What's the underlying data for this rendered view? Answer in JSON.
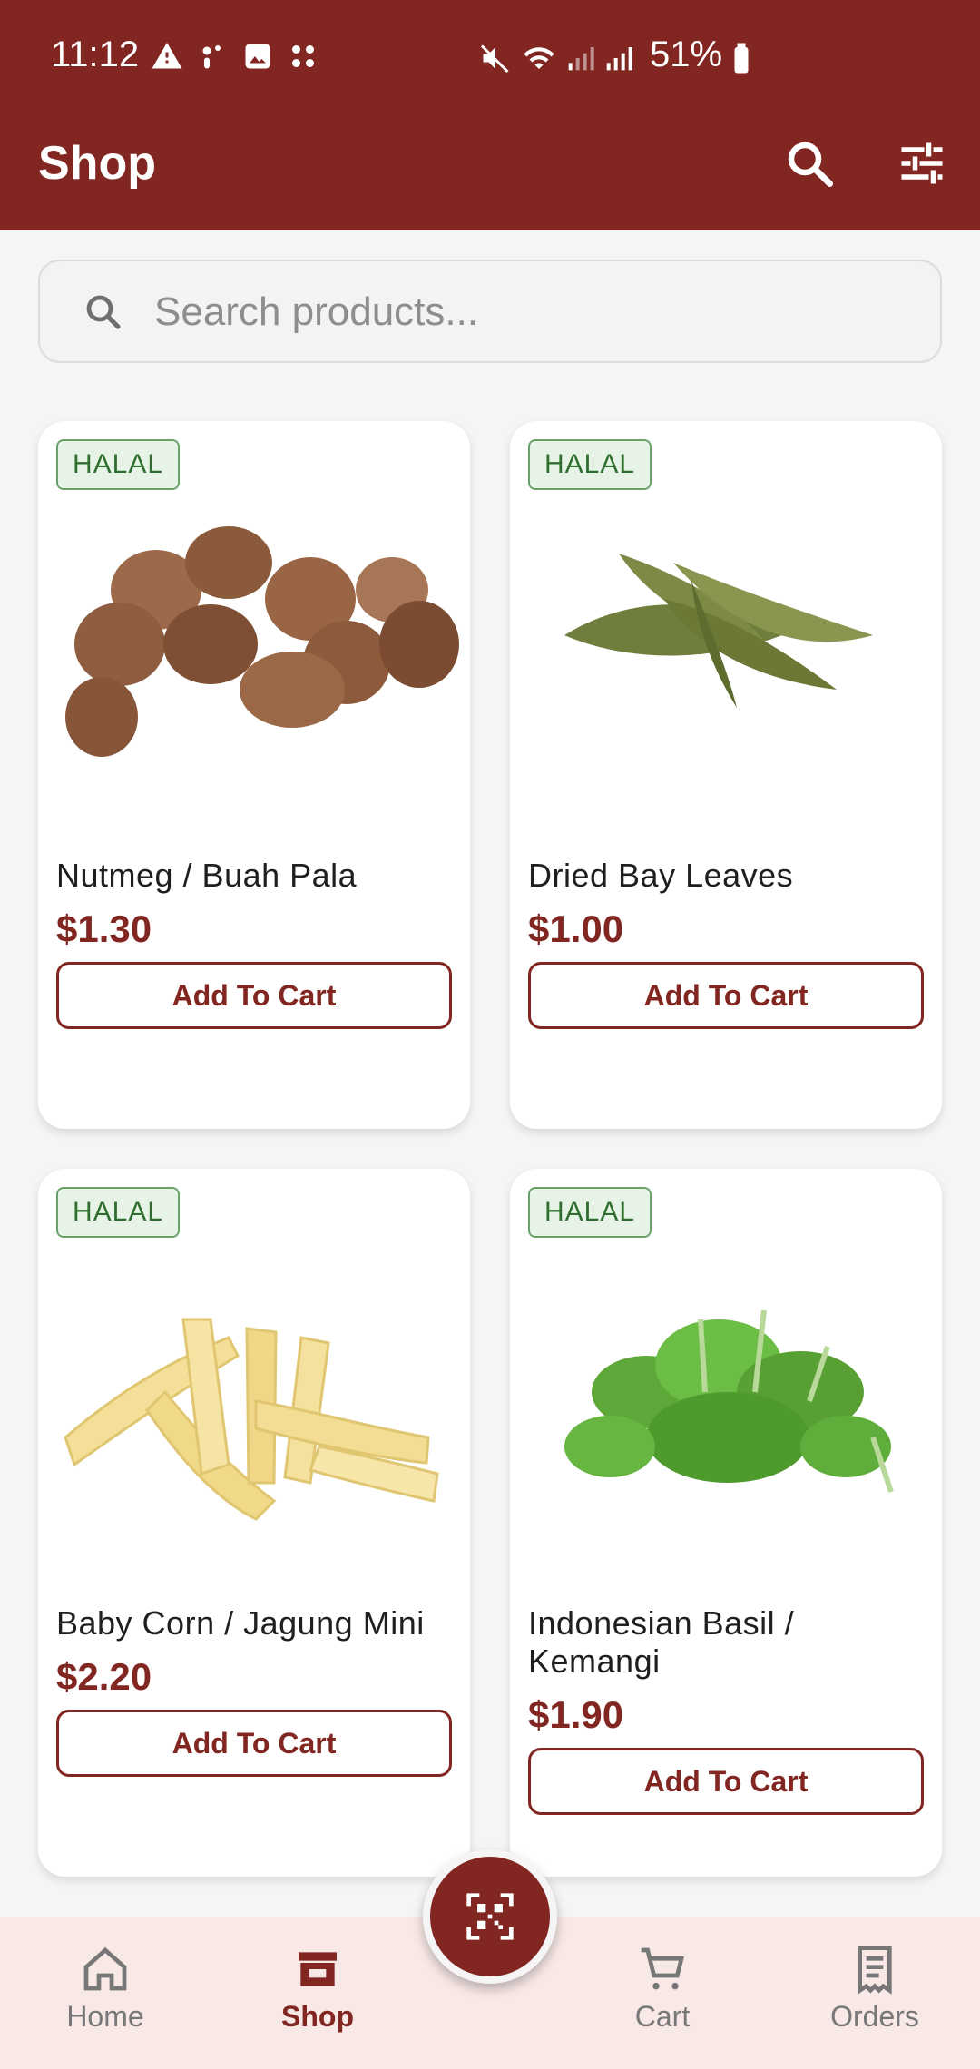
{
  "status_bar": {
    "time": "11:12",
    "battery": "51%"
  },
  "app_bar": {
    "title": "Shop",
    "search_icon": "search-icon",
    "filter_icon": "tune-icon"
  },
  "search": {
    "placeholder": "Search products..."
  },
  "products": [
    {
      "badge": "HALAL",
      "name": "Nutmeg / Buah Pala",
      "price": "$1.30",
      "button": "Add To Cart"
    },
    {
      "badge": "HALAL",
      "name": "Dried Bay Leaves",
      "price": "$1.00",
      "button": "Add To Cart"
    },
    {
      "badge": "HALAL",
      "name": "Baby Corn / Jagung Mini",
      "price": "$2.20",
      "button": "Add To Cart"
    },
    {
      "badge": "HALAL",
      "name": "Indonesian Basil / Kemangi",
      "price": "$1.90",
      "button": "Add To Cart"
    }
  ],
  "bottom_nav": {
    "items": [
      {
        "label": "Home",
        "icon": "home-icon"
      },
      {
        "label": "Shop",
        "icon": "store-icon"
      },
      {
        "label": "Cart",
        "icon": "cart-icon"
      },
      {
        "label": "Orders",
        "icon": "receipt-icon"
      }
    ],
    "fab_icon": "qr-scan-icon"
  },
  "colors": {
    "primary": "#822621",
    "halal_green": "#2f6e2f",
    "nav_bg": "#f8e8e6"
  }
}
